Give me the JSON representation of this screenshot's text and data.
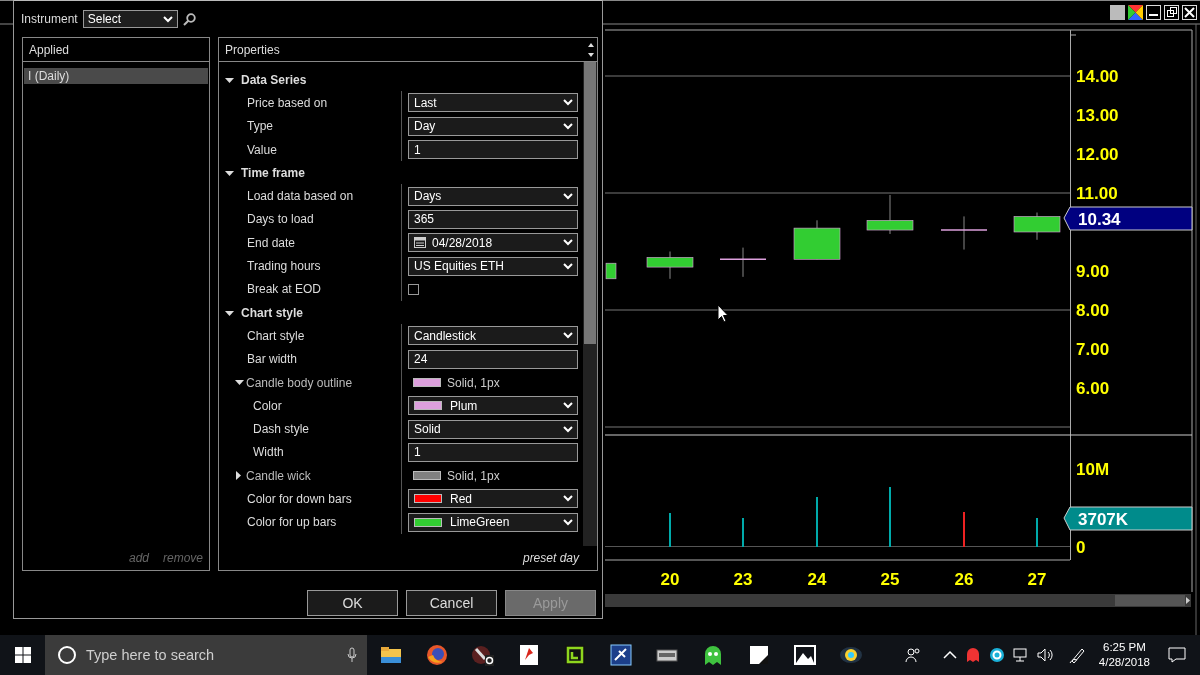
{
  "chart_window": {
    "price_axis": [
      "14.00",
      "13.00",
      "12.00",
      "11.00",
      "9.00",
      "8.00",
      "7.00",
      "6.00"
    ],
    "price_marker": "10.34",
    "volume_axis": [
      "10M",
      "0"
    ],
    "volume_marker": "3707K",
    "date_axis": [
      "20",
      "23",
      "24",
      "25",
      "26",
      "27"
    ]
  },
  "dialog": {
    "instrument_label": "Instrument",
    "instrument_select": "Select",
    "applied": {
      "title": "Applied",
      "items": [
        {
          "label": "I (Daily)",
          "selected": true
        }
      ],
      "links": [
        "add",
        "remove"
      ]
    },
    "properties": {
      "title": "Properties",
      "footer": "preset day",
      "sections": [
        {
          "title": "Data Series",
          "expanded": true,
          "rows": [
            {
              "label": "Price based on",
              "kind": "dropdown",
              "value": "Last"
            },
            {
              "label": "Type",
              "kind": "dropdown",
              "value": "Day"
            },
            {
              "label": "Value",
              "kind": "text",
              "value": "1"
            }
          ]
        },
        {
          "title": "Time frame",
          "expanded": true,
          "rows": [
            {
              "label": "Load data based on",
              "kind": "dropdown",
              "value": "Days"
            },
            {
              "label": "Days to load",
              "kind": "text",
              "value": "365"
            },
            {
              "label": "End date",
              "kind": "date",
              "value": "04/28/2018"
            },
            {
              "label": "Trading hours",
              "kind": "dropdown",
              "value": "US Equities ETH"
            },
            {
              "label": "Break at EOD",
              "kind": "checkbox",
              "checked": false
            }
          ]
        },
        {
          "title": "Chart style",
          "expanded": true,
          "rows": [
            {
              "label": "Chart style",
              "kind": "dropdown",
              "value": "Candlestick"
            },
            {
              "label": "Bar width",
              "kind": "text",
              "value": "24"
            },
            {
              "label": "Candle body outline",
              "kind": "group",
              "expanded": true,
              "color": "#dda0dd",
              "value": "Solid, 1px",
              "children": [
                {
                  "label": "Color",
                  "kind": "color",
                  "color": "#dda0dd",
                  "value": "Plum"
                },
                {
                  "label": "Dash style",
                  "kind": "dropdown",
                  "value": "Solid"
                },
                {
                  "label": "Width",
                  "kind": "text",
                  "value": "1"
                }
              ]
            },
            {
              "label": "Candle wick",
              "kind": "group",
              "expanded": false,
              "color": "#808080",
              "value": "Solid, 1px"
            },
            {
              "label": "Color for down bars",
              "kind": "color",
              "color": "#ff0000",
              "value": "Red"
            },
            {
              "label": "Color for up bars",
              "kind": "color",
              "color": "#32cd32",
              "value": "LimeGreen"
            }
          ]
        }
      ]
    },
    "buttons": [
      {
        "label": "OK",
        "disabled": false
      },
      {
        "label": "Cancel",
        "disabled": false
      },
      {
        "label": "Apply",
        "disabled": true
      }
    ]
  },
  "taskbar": {
    "search_placeholder": "Type here to search",
    "time": "6:25 PM",
    "date": "4/28/2018"
  }
}
